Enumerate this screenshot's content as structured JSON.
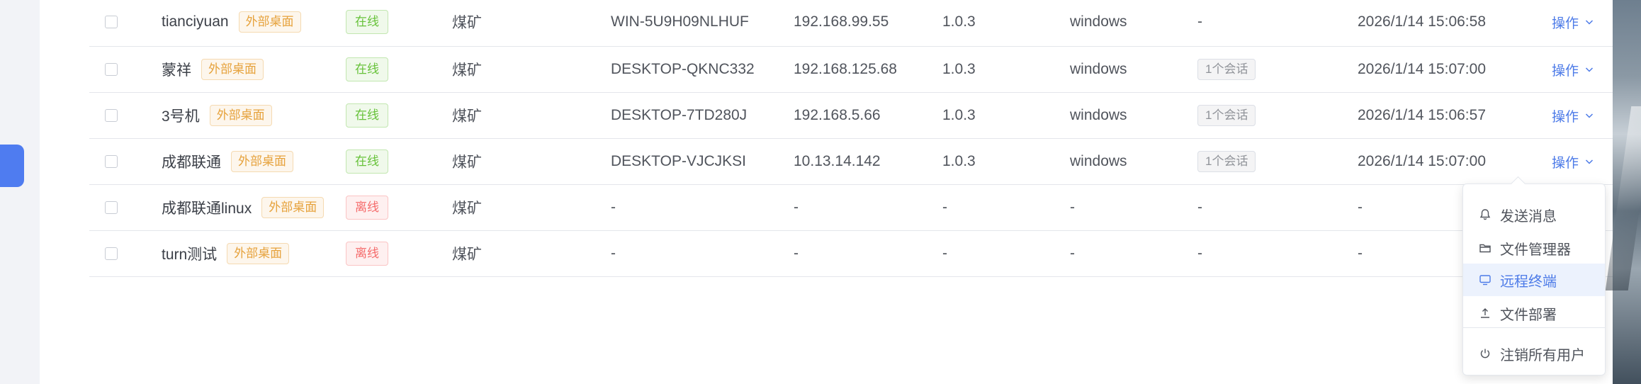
{
  "table": {
    "rows": [
      {
        "name": "tianciyuan",
        "tag": "外部桌面",
        "status": "在线",
        "status_kind": "online",
        "group": "煤矿",
        "host": "WIN-5U9H09NLHUF",
        "ip": "192.168.99.55",
        "version": "1.0.3",
        "os": "windows",
        "session": "-",
        "session_is_tag": false,
        "time": "2026/1/14 15:06:58",
        "op": "操作"
      },
      {
        "name": "蒙祥",
        "tag": "外部桌面",
        "status": "在线",
        "status_kind": "online",
        "group": "煤矿",
        "host": "DESKTOP-QKNC332",
        "ip": "192.168.125.68",
        "version": "1.0.3",
        "os": "windows",
        "session": "1个会话",
        "session_is_tag": true,
        "time": "2026/1/14 15:07:00",
        "op": "操作"
      },
      {
        "name": "3号机",
        "tag": "外部桌面",
        "status": "在线",
        "status_kind": "online",
        "group": "煤矿",
        "host": "DESKTOP-7TD280J",
        "ip": "192.168.5.66",
        "version": "1.0.3",
        "os": "windows",
        "session": "1个会话",
        "session_is_tag": true,
        "time": "2026/1/14 15:06:57",
        "op": "操作"
      },
      {
        "name": "成都联通",
        "tag": "外部桌面",
        "status": "在线",
        "status_kind": "online",
        "group": "煤矿",
        "host": "DESKTOP-VJCJKSI",
        "ip": "10.13.14.142",
        "version": "1.0.3",
        "os": "windows",
        "session": "1个会话",
        "session_is_tag": true,
        "time": "2026/1/14 15:07:00",
        "op": "操作"
      },
      {
        "name": "成都联通linux",
        "tag": "外部桌面",
        "status": "离线",
        "status_kind": "offline",
        "group": "煤矿",
        "host": "-",
        "ip": "-",
        "version": "-",
        "os": "-",
        "session": "-",
        "session_is_tag": false,
        "time": "-",
        "op": ""
      },
      {
        "name": "turn测试",
        "tag": "外部桌面",
        "status": "离线",
        "status_kind": "offline",
        "group": "煤矿",
        "host": "-",
        "ip": "-",
        "version": "-",
        "os": "-",
        "session": "-",
        "session_is_tag": false,
        "time": "-",
        "op": ""
      }
    ]
  },
  "dropdown": {
    "items": [
      {
        "label": "发送消息",
        "icon": "bell-icon",
        "active": false
      },
      {
        "label": "文件管理器",
        "icon": "folder-icon",
        "active": false
      },
      {
        "label": "远程终端",
        "icon": "monitor-icon",
        "active": true
      },
      {
        "label": "文件部署",
        "icon": "upload-icon",
        "active": false
      },
      {
        "label": "注销所有用户",
        "icon": "power-icon",
        "active": false
      }
    ]
  },
  "colors": {
    "accent": "#4d7be8",
    "online": "#67c23a",
    "offline": "#f56c6c",
    "warning": "#e6a23c"
  }
}
